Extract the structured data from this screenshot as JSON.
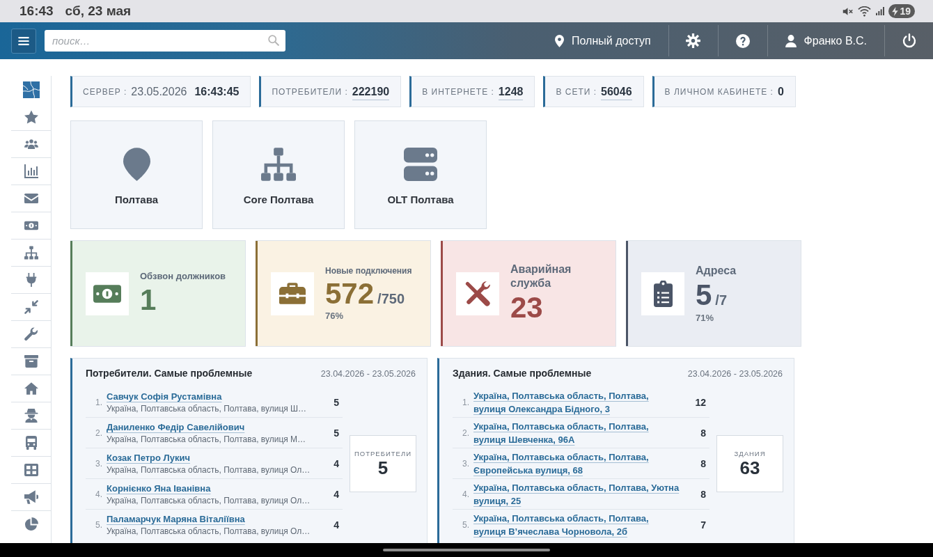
{
  "status_bar": {
    "time": "16:43",
    "date": "сб, 23 мая",
    "battery": "19"
  },
  "header": {
    "search": {
      "placeholder": "поиск…"
    },
    "access": "Полный доступ",
    "user": "Франко В.С."
  },
  "stats": [
    {
      "label": "СЕРВЕР :",
      "date": "23.05.2026",
      "value": "16:43:45",
      "link": false
    },
    {
      "label": "ПОТРЕБИТЕЛИ :",
      "value": "222190",
      "link": true
    },
    {
      "label": "В ИНТЕРНЕТЕ :",
      "value": "1248",
      "link": true
    },
    {
      "label": "В СЕТИ :",
      "value": "56046",
      "link": true
    },
    {
      "label": "В ЛИЧНОМ КАБИНЕТЕ :",
      "value": "0",
      "link": false
    }
  ],
  "locations": [
    {
      "kind": "city",
      "name": "Полтава"
    },
    {
      "kind": "core",
      "name": "Core Полтава"
    },
    {
      "kind": "olt",
      "name": "OLT Полтава"
    }
  ],
  "cards": [
    {
      "kind": "debtors",
      "title": "Обзвон должников",
      "value": "1",
      "color": "#567d5a"
    },
    {
      "kind": "connections",
      "title": "Новые подключения",
      "value": "572",
      "total": "/750",
      "percent": "76%",
      "color": "#8b6f36"
    },
    {
      "kind": "emergency",
      "title": "Аварийная служба",
      "value": "23",
      "color": "#9c4a48"
    },
    {
      "kind": "addresses",
      "title": "Адреса",
      "value": "5",
      "total": "/7",
      "percent": "71%",
      "color": "#4b5567"
    }
  ],
  "panels": [
    {
      "kind": "customers",
      "title": "Потребители. Самые проблемные",
      "period": "23.04.2026 - 23.05.2026",
      "rows": [
        {
          "number": "1.",
          "name": "Савчук Софія Рустамівна",
          "address": "Україна, Полтавська область, Полтава, вулиця Ш…",
          "count": "5"
        },
        {
          "number": "2.",
          "name": "Даниленко Федір Савелійович",
          "address": "Україна, Полтавська область, Полтава, вулиця М…",
          "count": "5"
        },
        {
          "number": "3.",
          "name": "Козак Петро Лукич",
          "address": "Україна, Полтавська область, Полтава, вулиця Ол…",
          "count": "4"
        },
        {
          "number": "4.",
          "name": "Корнієнко Яна Іванівна",
          "address": "Україна, Полтавська область, Полтава, вулиця Ол…",
          "count": "4"
        },
        {
          "number": "5.",
          "name": "Паламарчук Маряна Віталіївна",
          "address": "Україна, Полтавська область, Полтава, вулиця Ол…",
          "count": "4"
        }
      ],
      "summary": {
        "label": "ПОТРЕБИТЕЛИ",
        "value": "5"
      }
    },
    {
      "kind": "buildings",
      "title": "Здания. Самые проблемные",
      "period": "23.04.2026 - 23.05.2026",
      "rows": [
        {
          "number": "1.",
          "name": "Україна, Полтавська область, Полтава, вулиця Олександра Бідного, 3",
          "count": "12"
        },
        {
          "number": "2.",
          "name": "Україна, Полтавська область, Полтава, вулиця Шевченка, 96А",
          "count": "8"
        },
        {
          "number": "3.",
          "name": "Україна, Полтавська область, Полтава, Європейська вулиця, 68",
          "count": "8"
        },
        {
          "number": "4.",
          "name": "Україна, Полтавська область, Полтава, Уютна вулиця, 25",
          "count": "8"
        },
        {
          "number": "5.",
          "name": "Україна, Полтавська область, Полтава, вулиця В’ячеслава Чорновола, 2б",
          "count": "7"
        }
      ],
      "summary": {
        "label": "ЗДАНИЯ",
        "value": "63"
      }
    }
  ]
}
